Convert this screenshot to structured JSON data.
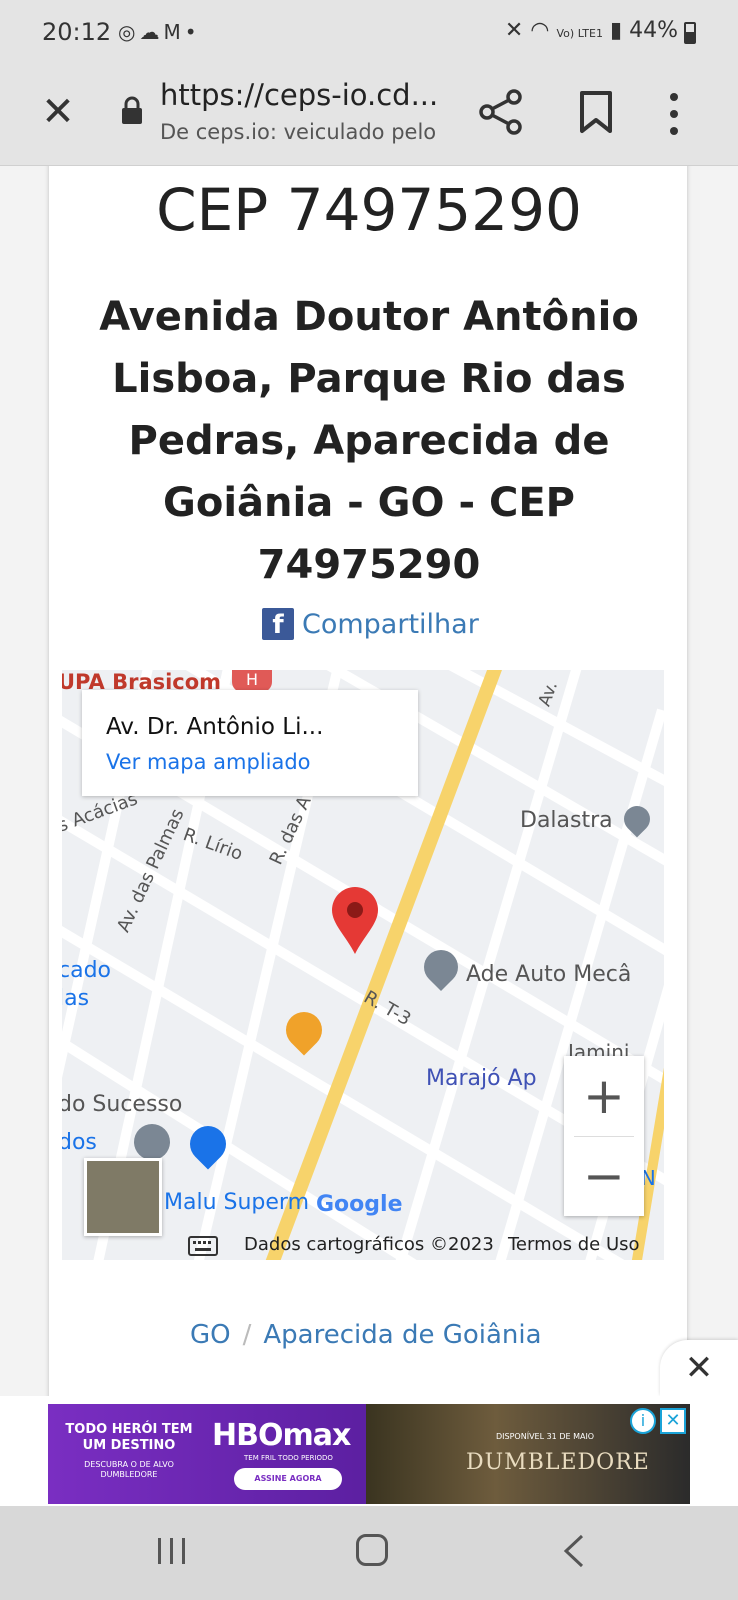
{
  "status_bar": {
    "time": "20:12",
    "notification_icons": [
      "whatsapp-icon",
      "cloud-icon",
      "gmail-icon",
      "dot-icon"
    ],
    "right_icons": [
      "mute-icon",
      "wifi-icon",
      "volte-icon",
      "signal-icon"
    ],
    "network_label": "Vo) LTE1",
    "battery": "44%"
  },
  "browser": {
    "url": "https://ceps-io.cd...",
    "subtitle": "De ceps.io: veiculado pelo",
    "actions": [
      "close-icon",
      "share-icon",
      "bookmark-icon",
      "more-icon"
    ]
  },
  "page": {
    "cep_title": "CEP 74975290",
    "address": "Avenida Doutor Antônio Lisboa, Parque Rio das Pedras, Aparecida de Goiânia - GO - CEP 74975290",
    "share_label": "Compartilhar",
    "breadcrumb": [
      "GO",
      "Aparecida de Goiânia"
    ],
    "breadcrumb_sep": "/"
  },
  "map": {
    "info_title": "Av. Dr. Antônio Li...",
    "info_link": "Ver mapa ampliado",
    "labels": {
      "upa": "UPA Brasicom",
      "acacias": "s Acácias",
      "palmas": "Av. das Palmas",
      "lirio": "R. Lírio",
      "das_a": "R. das A",
      "av_top": "Av.",
      "dalastra": "Dalastra",
      "cado": "cado",
      "las": "las",
      "ade_auto": "Ade Auto Mecâ",
      "rt3": "R. T-3",
      "jamini": "Jamini",
      "sucesso": "do Sucesso",
      "dos": "dos",
      "marajo": "Marajó Ap",
      "malu": "Malu Superm",
      "google": "Google",
      "sm": "SN"
    },
    "zoom_in": "+",
    "zoom_out": "−",
    "attribution": "Dados cartográficos ©2023",
    "terms": "Termos de Uso"
  },
  "ad": {
    "tagline": "TODO HERÓI TEM UM DESTINO",
    "small_text": "DESCUBRA O DE ALVO DUMBLEDORE",
    "logo": "HBOmax",
    "logo_sub": "TEM FRIL TODO PERIODO",
    "cta": "ASSINE AGORA",
    "movie": "DUMBLEDORE",
    "date": "DISPONÍVEL 31 DE MAIO",
    "info_icon": "i",
    "close_icon": "✕",
    "dismiss": "✕"
  },
  "colors": {
    "link": "#3b7ab5",
    "map_link": "#1a73e8",
    "road_major": "#f7d36b",
    "pin": "#e53935",
    "facebook": "#3b5998"
  }
}
